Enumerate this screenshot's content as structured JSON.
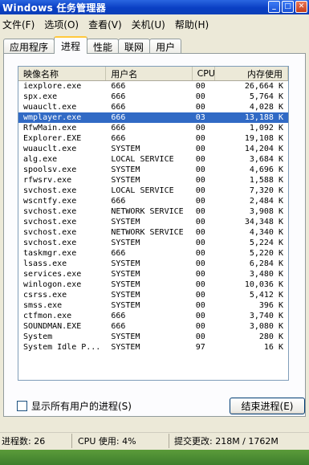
{
  "window": {
    "title": "Windows 任务管理器",
    "controls": [
      "minimize-icon",
      "maximize-icon",
      "close-icon"
    ]
  },
  "menu": [
    "文件(F)",
    "选项(O)",
    "查看(V)",
    "关机(U)",
    "帮助(H)"
  ],
  "tabs": [
    {
      "label": "应用程序",
      "active": false
    },
    {
      "label": "进程",
      "active": true
    },
    {
      "label": "性能",
      "active": false
    },
    {
      "label": "联网",
      "active": false
    },
    {
      "label": "用户",
      "active": false
    }
  ],
  "columns": {
    "name": "映像名称",
    "user": "用户名",
    "cpu": "CPU",
    "mem": "内存使用"
  },
  "processes": [
    {
      "name": "iexplore.exe",
      "user": "666",
      "cpu": "00",
      "mem": "26,664 K"
    },
    {
      "name": "spx.exe",
      "user": "666",
      "cpu": "00",
      "mem": "5,764 K"
    },
    {
      "name": "wuauclt.exe",
      "user": "666",
      "cpu": "00",
      "mem": "4,028 K"
    },
    {
      "name": "wmplayer.exe",
      "user": "666",
      "cpu": "03",
      "mem": "13,188 K",
      "selected": true
    },
    {
      "name": "RfwMain.exe",
      "user": "666",
      "cpu": "00",
      "mem": "1,092 K"
    },
    {
      "name": "Explorer.EXE",
      "user": "666",
      "cpu": "00",
      "mem": "19,108 K"
    },
    {
      "name": "wuauclt.exe",
      "user": "SYSTEM",
      "cpu": "00",
      "mem": "14,204 K"
    },
    {
      "name": "alg.exe",
      "user": "LOCAL SERVICE",
      "cpu": "00",
      "mem": "3,684 K"
    },
    {
      "name": "spoolsv.exe",
      "user": "SYSTEM",
      "cpu": "00",
      "mem": "4,696 K"
    },
    {
      "name": "rfwsrv.exe",
      "user": "SYSTEM",
      "cpu": "00",
      "mem": "1,588 K"
    },
    {
      "name": "svchost.exe",
      "user": "LOCAL SERVICE",
      "cpu": "00",
      "mem": "7,320 K"
    },
    {
      "name": "wscntfy.exe",
      "user": "666",
      "cpu": "00",
      "mem": "2,484 K"
    },
    {
      "name": "svchost.exe",
      "user": "NETWORK SERVICE",
      "cpu": "00",
      "mem": "3,908 K"
    },
    {
      "name": "svchost.exe",
      "user": "SYSTEM",
      "cpu": "00",
      "mem": "34,348 K"
    },
    {
      "name": "svchost.exe",
      "user": "NETWORK SERVICE",
      "cpu": "00",
      "mem": "4,340 K"
    },
    {
      "name": "svchost.exe",
      "user": "SYSTEM",
      "cpu": "00",
      "mem": "5,224 K"
    },
    {
      "name": "taskmgr.exe",
      "user": "666",
      "cpu": "00",
      "mem": "5,220 K"
    },
    {
      "name": "lsass.exe",
      "user": "SYSTEM",
      "cpu": "00",
      "mem": "6,284 K"
    },
    {
      "name": "services.exe",
      "user": "SYSTEM",
      "cpu": "00",
      "mem": "3,480 K"
    },
    {
      "name": "winlogon.exe",
      "user": "SYSTEM",
      "cpu": "00",
      "mem": "10,036 K"
    },
    {
      "name": "csrss.exe",
      "user": "SYSTEM",
      "cpu": "00",
      "mem": "5,412 K"
    },
    {
      "name": "smss.exe",
      "user": "SYSTEM",
      "cpu": "00",
      "mem": "396 K"
    },
    {
      "name": "ctfmon.exe",
      "user": "666",
      "cpu": "00",
      "mem": "3,740 K"
    },
    {
      "name": "SOUNDMAN.EXE",
      "user": "666",
      "cpu": "00",
      "mem": "3,080 K"
    },
    {
      "name": "System",
      "user": "SYSTEM",
      "cpu": "00",
      "mem": "280 K"
    },
    {
      "name": "System Idle P...",
      "user": "SYSTEM",
      "cpu": "97",
      "mem": "16 K"
    }
  ],
  "show_all_users": {
    "label": "显示所有用户的进程(S)",
    "checked": false
  },
  "end_process_button": "结束进程(E)",
  "status": {
    "processes": "进程数: 26",
    "cpu": "CPU 使用: 4%",
    "commit": "提交更改: 218M / 1762M"
  },
  "colors": {
    "titlebar": "#0a3fc4",
    "selection": "#316ac5",
    "tab_accent": "#ffc83c",
    "taskbar": "#3d7e2c"
  }
}
